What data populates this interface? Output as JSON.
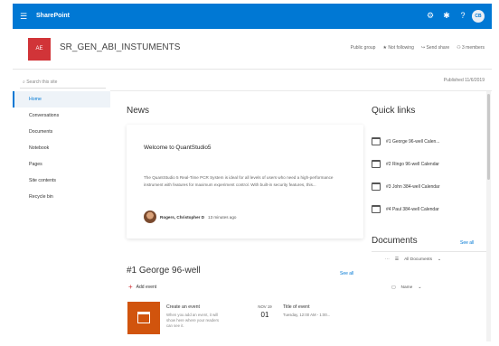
{
  "suite": {
    "brand": "SharePoint",
    "waffle_icon": "waffle-icon",
    "avatar_initials": "CB"
  },
  "site": {
    "logo_text": "AE",
    "title": "SR_GEN_ABI_INSTUMENTS",
    "actions": [
      "Public group",
      "★ Not following",
      "↪ Send share",
      "⚇ 3 members"
    ],
    "logo_color": "#d13438"
  },
  "nav": {
    "search_placeholder": "Search this site",
    "items": [
      {
        "label": "Home"
      },
      {
        "label": "Conversations"
      },
      {
        "label": "Documents"
      },
      {
        "label": "Notebook"
      },
      {
        "label": "Pages"
      },
      {
        "label": "Site contents"
      },
      {
        "label": "Recycle bin"
      }
    ]
  },
  "status": {
    "published": "Published 11/6/2019"
  },
  "news": {
    "title": "News",
    "heading": "Welcome to QuantStudio5",
    "body": "The QuantStudio 5 Real-Time PCR System is ideal for all levels of users who need a high-performance instrument with features for maximum experiment control. With built-in security features, this...",
    "author": "Rogers, Christopher D",
    "time": "13 minutes ago"
  },
  "quick_links": {
    "title": "Quick links",
    "items": [
      "#1 George 96-well Calen...",
      "#2 Ringo 96-well Calendar",
      "#3 John 384-well Calendar",
      "#4 Paul 384-well Calendar"
    ]
  },
  "documents": {
    "title": "Documents",
    "see_all": "See all",
    "filter_label": "All Documents",
    "column_name": "Name"
  },
  "events": {
    "title": "#1 George 96-well",
    "see_all": "See all",
    "add_label": "Add event",
    "create_title": "Create an event",
    "create_desc": "When you add an event, it will show here where your readers can see it.",
    "month": "NOV 19",
    "day": "01",
    "event_name": "Title of event",
    "event_time": "Tuesday, 12:00 AM - 1:00..."
  }
}
